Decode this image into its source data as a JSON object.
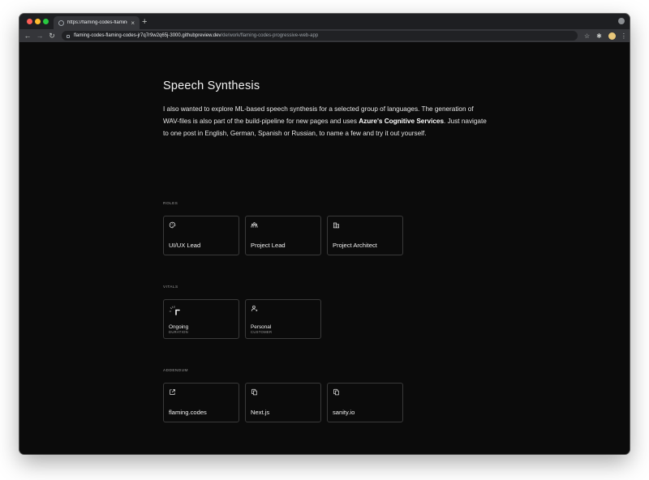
{
  "browser": {
    "tab_title": "https://flaming-codes-flaming",
    "tab_close": "×",
    "new_tab": "+",
    "url_host": "flaming-codes-flaming-codes-jr7q7r9w2q65j-3000.githubpreview.dev",
    "url_path": "/de/work/flaming-codes-progressive-web-app"
  },
  "article": {
    "heading": "Speech Synthesis",
    "para_part1": "I also wanted to explore ML-based speech synthesis for a selected group of languages. The generation of WAV-files is also part of the build-pipeline for new pages and uses ",
    "para_bold": "Azure's Cognitive Services",
    "para_part2": ". Just navigate to one post in English, German, Spanish or Russian, to name a few and try it out yourself."
  },
  "roles": {
    "label": "ROLES",
    "items": [
      {
        "label": "UI/UX Lead",
        "icon": "palette-icon"
      },
      {
        "label": "Project Lead",
        "icon": "team-icon"
      },
      {
        "label": "Project Architect",
        "icon": "building-icon"
      }
    ]
  },
  "vitals": {
    "label": "VITALS",
    "items": [
      {
        "label": "Ongoing",
        "sub": "DURATION",
        "icon": "progress-icon"
      },
      {
        "label": "Personal",
        "sub": "CUSTOMER",
        "icon": "user-icon"
      }
    ]
  },
  "addendum": {
    "label": "ADDENDUM",
    "items": [
      {
        "label": "flaming.codes",
        "icon": "external-link-icon"
      },
      {
        "label": "Next.js",
        "icon": "copy-icon"
      },
      {
        "label": "sanity.io",
        "icon": "copy-icon"
      }
    ]
  },
  "colors": {
    "page_bg": "#0b0b0b",
    "card_border": "#3a3a3a",
    "text": "#e6e6e6"
  }
}
